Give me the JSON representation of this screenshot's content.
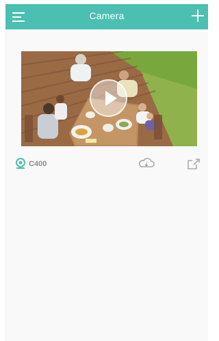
{
  "header": {
    "title": "Camera",
    "color": "#4bbfb1"
  },
  "camera": {
    "name": "C400",
    "icon_color": "#4bbfb1"
  },
  "icons": {
    "menu": "menu-icon",
    "add": "plus-icon",
    "play": "play-icon",
    "camera": "camera-icon",
    "cloud": "cloud-icon",
    "share": "share-icon"
  }
}
